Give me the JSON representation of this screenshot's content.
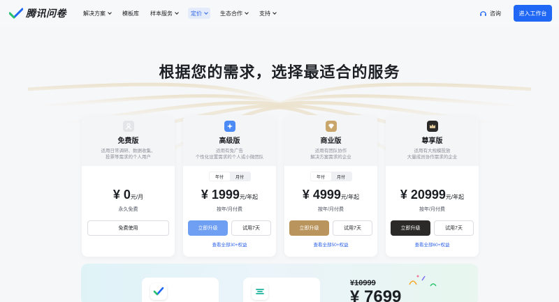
{
  "brand": {
    "name": "腾讯问卷"
  },
  "nav": {
    "items": [
      {
        "label": "解决方案",
        "has_menu": true,
        "active": false
      },
      {
        "label": "模板库",
        "has_menu": false,
        "active": false
      },
      {
        "label": "样本服务",
        "has_menu": true,
        "active": false
      },
      {
        "label": "定价",
        "has_menu": true,
        "active": true
      },
      {
        "label": "生态合作",
        "has_menu": true,
        "active": false
      },
      {
        "label": "支持",
        "has_menu": true,
        "active": false
      }
    ],
    "consult_label": "咨询",
    "enter_label": "进入工作台"
  },
  "hero": {
    "headline": "根据您的需求，选择最适合的服务"
  },
  "billing_toggle": {
    "annual": "年付",
    "monthly": "月付"
  },
  "plans": [
    {
      "name": "免费版",
      "desc_1": "适用日常调研、数据收集、",
      "desc_2": "投票等需求的个人用户",
      "price": "¥ 0",
      "unit": "元/月",
      "sub": "永久免费",
      "primary_btn": "免费使用"
    },
    {
      "name": "高级版",
      "desc_1": "适用有免广告",
      "desc_2": "个性化设置需求的个人或小微团队",
      "price": "¥ 1999",
      "unit": "元/年起",
      "sub": "按年/月付费",
      "primary_btn": "立即升级",
      "trial_btn": "试用7天",
      "rights": "查看全部30+权益"
    },
    {
      "name": "商业版",
      "desc_1": "适用有团队协作",
      "desc_2": "解决方案需求的企业",
      "price": "¥ 4999",
      "unit": "元/年起",
      "sub": "按年/月付费",
      "primary_btn": "立即升级",
      "trial_btn": "试用7天",
      "rights": "查看全部50+权益"
    },
    {
      "name": "尊享版",
      "desc_1": "适用有大规模投放",
      "desc_2": "大量成员协作需求的企业",
      "price": "¥ 20999",
      "unit": "元/年起",
      "sub": "按年/月付费",
      "primary_btn": "立即升级",
      "trial_btn": "试用7天",
      "rights": "查看全部60+权益"
    }
  ],
  "promo": {
    "old_price": "¥10999",
    "new_price": "¥ 7699"
  },
  "colors": {
    "accent": "#1f67f4",
    "link": "#2e63e9",
    "advanced_btn": "#6f9ff3",
    "business_btn": "#b9955d",
    "premium_btn": "#2b2a28"
  }
}
